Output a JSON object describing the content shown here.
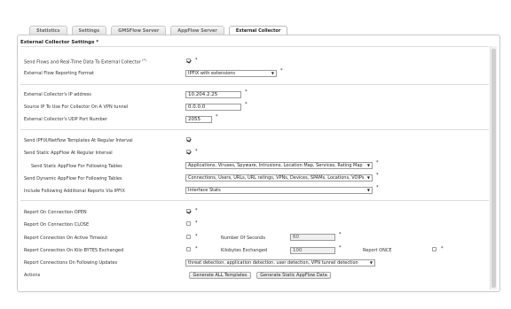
{
  "tabs": [
    {
      "label": "Statistics",
      "active": false
    },
    {
      "label": "Settings",
      "active": false
    },
    {
      "label": "GMSFlow Server",
      "active": false
    },
    {
      "label": "AppFlow Server",
      "active": false
    },
    {
      "label": "External Collector",
      "active": true
    }
  ],
  "panel": {
    "title": "External Collector Settings",
    "title_mark": "*"
  },
  "mark": "*",
  "fields": {
    "send_flows": {
      "label": "Send Flows and Real-Time Data To External Collector",
      "superscript": "(*)",
      "checked": true
    },
    "report_format": {
      "label": "External Flow Reporting Format",
      "value": "IPFIX with extensions"
    },
    "collector_ip": {
      "label": "External Collector's IP address",
      "value": "10.204.2.25"
    },
    "source_ip": {
      "label": "Source IP To Use For Collector On A VPN tunnel",
      "value": "0.0.0.0"
    },
    "udp_port": {
      "label": "External Collector's UDP Port Number",
      "value": "2055"
    },
    "send_templates": {
      "label": "Send IPFIX/Netflow Templates At Regular Interval",
      "checked": true
    },
    "send_static": {
      "label": "Send Static AppFlow At Regular Interval",
      "checked": true
    },
    "static_tables": {
      "label": "Send Static AppFlow For Following Tables",
      "value": "Applications, Viruses, Spyware, Intrusions, Location Map, Services, Rating Map"
    },
    "dynamic_tables": {
      "label": "Send Dynamic AppFlow For Following Tables",
      "value": "Connections, Users, URLs, URL ratings, VPNs, Devices, SPAMs, Locations, VOIPs"
    },
    "additional_reports": {
      "label": "Include Following Additional Reports Via IPFIX",
      "value": "Interface Stats"
    },
    "report_open": {
      "label": "Report On Connection OPEN",
      "checked": true
    },
    "report_close": {
      "label": "Report On Connection CLOSE",
      "checked": false
    },
    "active_timeout": {
      "label": "Report Connection On Active Timeout",
      "checked": false,
      "sub_label": "Number Of Seconds",
      "sub_value": "60"
    },
    "kilo_bytes": {
      "label": "Report Connection On Kilo BYTES Exchanged",
      "checked": false,
      "sub_label": "Kilobytes Exchanged",
      "sub_value": "100",
      "once_label": "Report ONCE",
      "once_checked": false
    },
    "following_updates": {
      "label": "Report Connections On Following Updates",
      "value": "threat detection, application detection, user detection, VPN tunnel detection"
    },
    "actions": {
      "label": "Actions",
      "btn_templates": "Generate ALL Templates",
      "btn_static": "Generate Static AppFlow Data"
    }
  }
}
